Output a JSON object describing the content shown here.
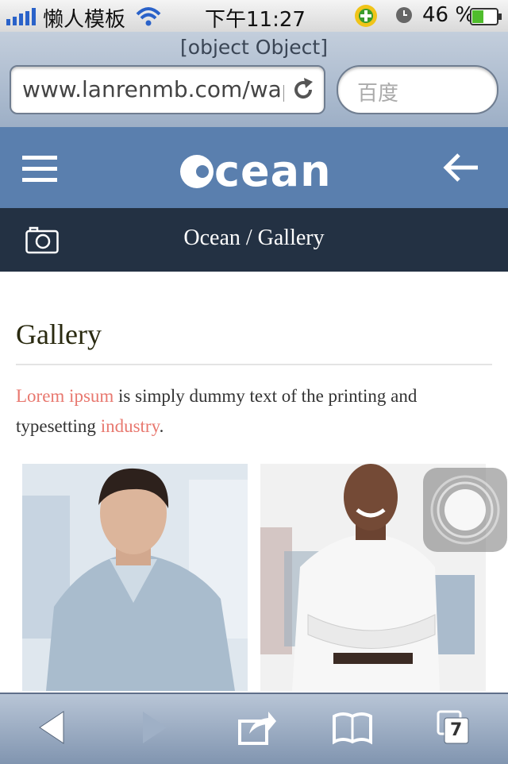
{
  "status_bar": {
    "carrier": "懒人模板",
    "time": "下午11:27",
    "battery": "46 %",
    "battery_level": 0.46
  },
  "browser": {
    "page_title": "[object Object]",
    "url": "www.lanrenmb.com/wap",
    "search_placeholder": "百度"
  },
  "site_header": {
    "logo_text": "cean",
    "logo_letter_icon": "O-drop-icon",
    "menu_icon": "hamburger-icon",
    "back_icon": "back-arrow-icon",
    "background": "#5a7fae"
  },
  "breadcrumb_bar": {
    "icon": "camera-icon",
    "text": "Ocean / Gallery",
    "background": "#233143"
  },
  "content": {
    "heading": "Gallery",
    "intro_link1": "Lorem ipsum",
    "intro_mid": " is simply dummy text of the printing and typesetting ",
    "intro_link2": "industry",
    "intro_end": ".",
    "accent": "#e8786f"
  },
  "toolbar": {
    "tabs_count": "7"
  }
}
